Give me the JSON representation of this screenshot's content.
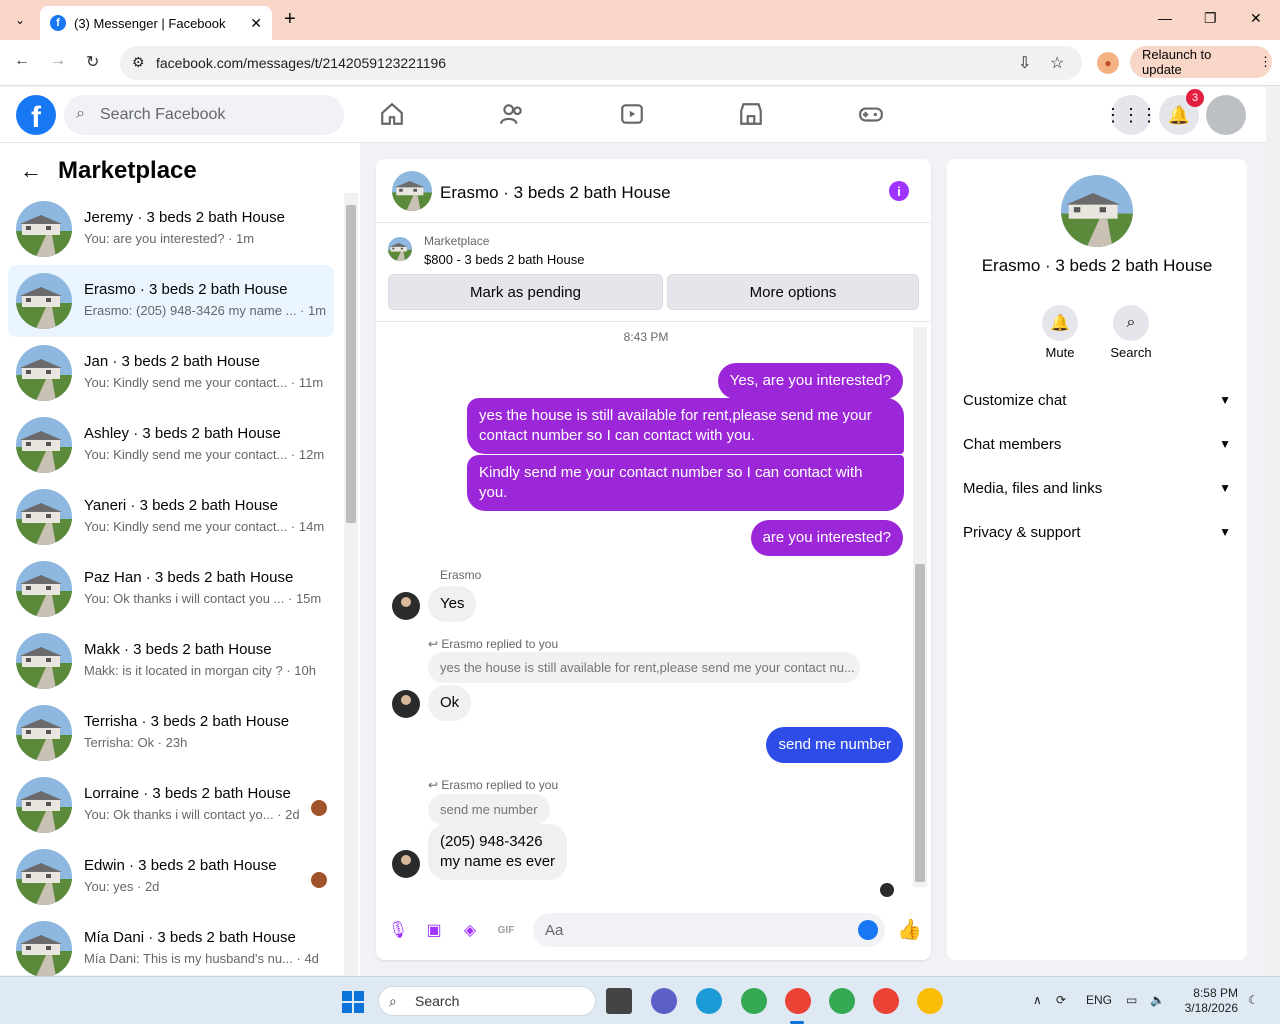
{
  "browser": {
    "tab_title": "(3) Messenger | Facebook",
    "url": "facebook.com/messages/t/2142059123221196",
    "relaunch_label": "Relaunch to update"
  },
  "fbnav": {
    "search_placeholder": "Search Facebook",
    "notification_count": "3"
  },
  "sidebar": {
    "title": "Marketplace",
    "conversations": [
      {
        "name": "Jeremy · 3 beds 2 bath House",
        "preview": "You: are you interested? · 1m"
      },
      {
        "name": "Erasmo · 3 beds 2 bath House",
        "preview": "Erasmo: (205) 948-3426 my name ... · 1m"
      },
      {
        "name": "Jan · 3 beds 2 bath House",
        "preview": "You: Kindly send me your contact... · 11m"
      },
      {
        "name": "Ashley · 3 beds 2 bath House",
        "preview": "You: Kindly send me your contact... · 12m"
      },
      {
        "name": "Yaneri · 3 beds 2 bath House",
        "preview": "You: Kindly send me your contact... · 14m"
      },
      {
        "name": "Paz Han · 3 beds 2 bath House",
        "preview": "You: Ok thanks i will contact you ... · 15m"
      },
      {
        "name": "Makk · 3 beds 2 bath House",
        "preview": "Makk: is it located in morgan city ? · 10h"
      },
      {
        "name": "Terrisha · 3 beds 2 bath House",
        "preview": "Terrisha: Ok · 23h"
      },
      {
        "name": "Lorraine · 3 beds 2 bath House",
        "preview": "You: Ok thanks i will contact yo... · 2d"
      },
      {
        "name": "Edwin · 3 beds 2 bath House",
        "preview": "You: yes · 2d"
      },
      {
        "name": "Mía Dani · 3 beds 2 bath House",
        "preview": "Mía Dani: This is my husband's nu... · 4d"
      }
    ]
  },
  "chat": {
    "title": "Erasmo · 3 beds 2 bath House",
    "marketplace_label": "Marketplace",
    "listing": "$800 - 3 beds 2 bath House",
    "mark_pending": "Mark as pending",
    "more_options": "More options",
    "timestamp": "8:43 PM",
    "messages": {
      "m1": "Yes, are you interested?",
      "m2": "yes the house is still available for rent,please send me your contact number so I can contact with you.",
      "m3": "Kindly send me your contact number so I can contact with you.",
      "m4": "are you interested?",
      "sender1": "Erasmo",
      "m5": "Yes",
      "reply_label1": "Erasmo replied to you",
      "reply_ctx1": "yes the house is still available for rent,please send me your contact nu...",
      "m6": "Ok",
      "m7": "send me number",
      "reply_label2": "Erasmo replied to you",
      "reply_ctx2": "send me number",
      "m8a": "(205) 948-3426",
      "m8b": "my name es ever"
    },
    "composer_placeholder": "Aa"
  },
  "rpanel": {
    "title": "Erasmo · 3 beds 2 bath House",
    "mute": "Mute",
    "search": "Search",
    "rows": [
      "Customize chat",
      "Chat members",
      "Media, files and links",
      "Privacy & support"
    ]
  },
  "taskbar": {
    "search": "Search",
    "lang": "ENG",
    "time": "8:58 PM",
    "date": "3/18/2026"
  }
}
